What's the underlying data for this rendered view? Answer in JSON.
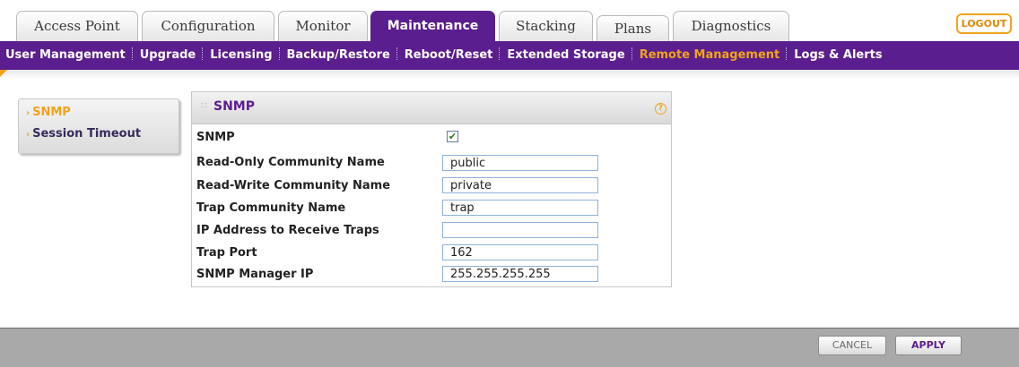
{
  "top_tabs": [
    {
      "label": "Access Point",
      "active": false
    },
    {
      "label": "Configuration",
      "active": false
    },
    {
      "label": "Monitor",
      "active": false
    },
    {
      "label": "Maintenance",
      "active": true
    },
    {
      "label": "Stacking",
      "active": false
    },
    {
      "label": "Plans",
      "active": false
    },
    {
      "label": "Diagnostics",
      "active": false
    }
  ],
  "logout_label": "LOGOUT",
  "sub_nav": [
    {
      "label": "User Management",
      "active": false
    },
    {
      "label": "Upgrade",
      "active": false
    },
    {
      "label": "Licensing",
      "active": false
    },
    {
      "label": "Backup/Restore",
      "active": false
    },
    {
      "label": "Reboot/Reset",
      "active": false
    },
    {
      "label": "Extended Storage",
      "active": false
    },
    {
      "label": "Remote Management",
      "active": true
    },
    {
      "label": "Logs & Alerts",
      "active": false
    }
  ],
  "left_menu": [
    {
      "label": "SNMP",
      "active": true
    },
    {
      "label": "Session Timeout",
      "active": false
    }
  ],
  "panel": {
    "title": "SNMP",
    "help_icon": "question-circle-icon",
    "snmp_label": "SNMP",
    "snmp_enabled": true,
    "fields": [
      {
        "label": "Read-Only Community Name",
        "value": "public"
      },
      {
        "label": "Read-Write Community Name",
        "value": "private"
      },
      {
        "label": "Trap Community Name",
        "value": "trap"
      },
      {
        "label": "IP Address to Receive Traps",
        "value": ""
      },
      {
        "label": "Trap Port",
        "value": "162"
      },
      {
        "label": "SNMP Manager IP",
        "value": "255.255.255.255"
      }
    ]
  },
  "buttons": {
    "cancel": "CANCEL",
    "apply": "APPLY"
  },
  "colors": {
    "brand_purple": "#5b1e8e",
    "accent_orange": "#f0a31a",
    "footer_gray": "#a9a9a9"
  }
}
